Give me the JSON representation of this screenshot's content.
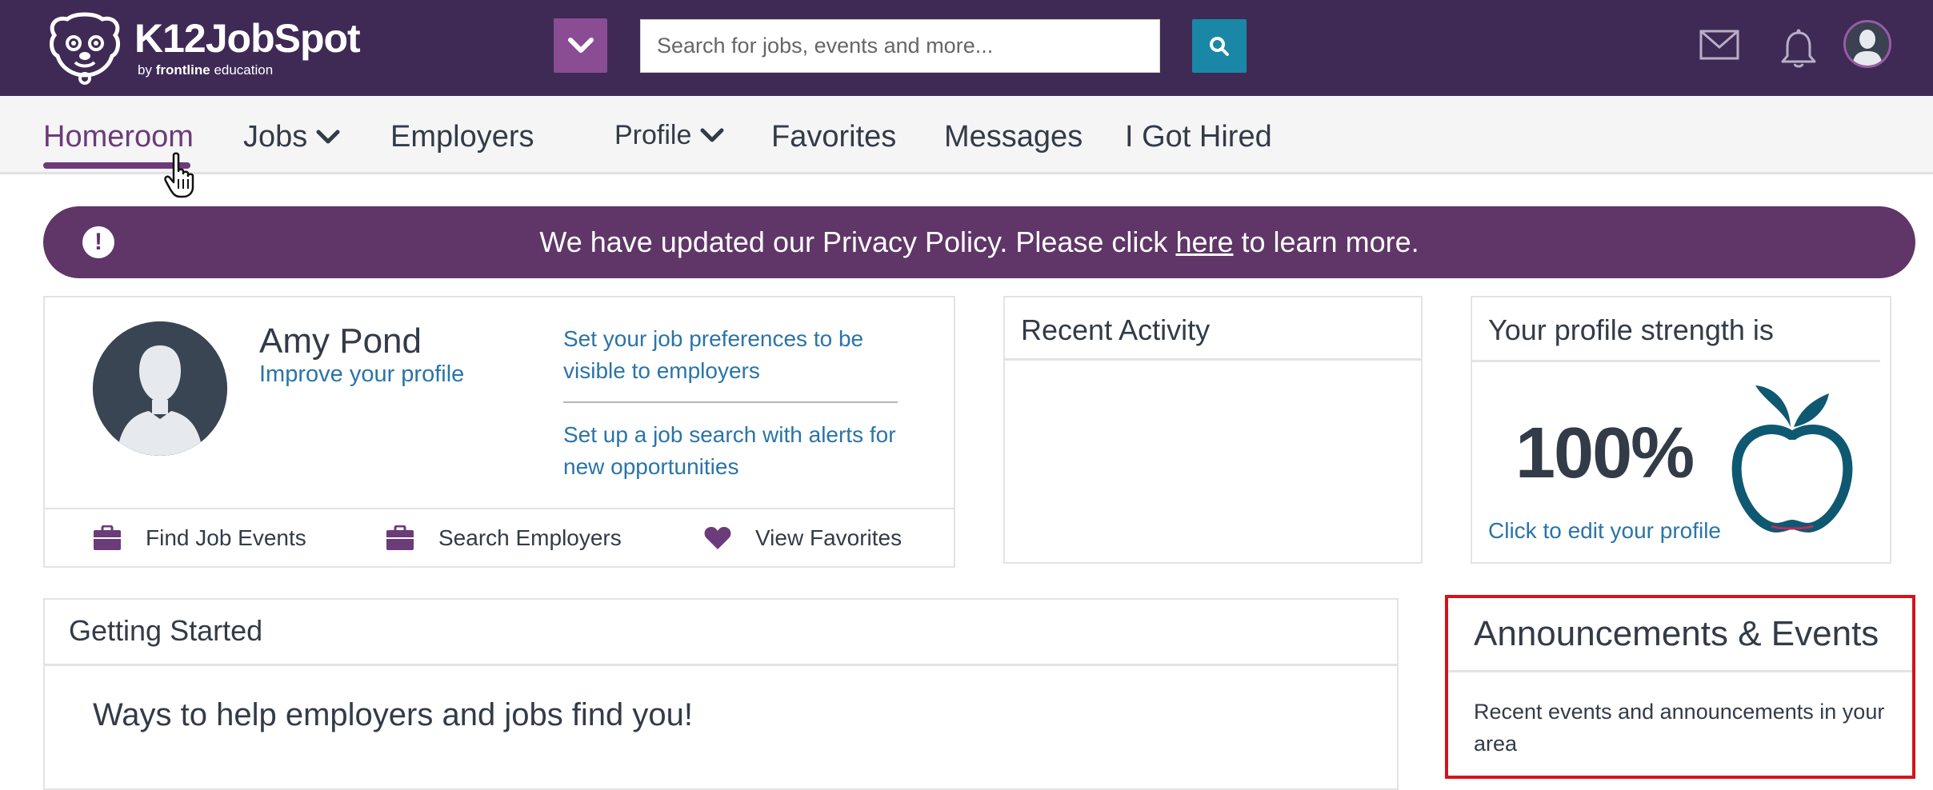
{
  "header": {
    "brand_name": "K12JobSpot",
    "brand_by": "by",
    "brand_company": "frontline",
    "brand_suffix": "education",
    "search_placeholder": "Search for jobs, events and more..."
  },
  "nav": {
    "items": [
      {
        "label": "Homeroom",
        "active": true
      },
      {
        "label": "Jobs",
        "has_dropdown": true
      },
      {
        "label": "Employers"
      },
      {
        "label": "Profile",
        "has_dropdown": true
      },
      {
        "label": "Favorites"
      },
      {
        "label": "Messages"
      },
      {
        "label": "I Got Hired"
      }
    ]
  },
  "banner": {
    "icon": "!",
    "text_before": "We have updated our Privacy Policy. Please click ",
    "link_text": "here",
    "text_after": " to learn more."
  },
  "profile": {
    "name": "Amy Pond",
    "improve_link": "Improve your profile",
    "preferences_link": "Set your job preferences to be visible to employers",
    "search_alert_link": "Set up a job search with alerts for new opportunities",
    "actions": [
      {
        "label": "Find Job Events",
        "icon": "briefcase-icon"
      },
      {
        "label": "Search Employers",
        "icon": "briefcase-icon"
      },
      {
        "label": "View Favorites",
        "icon": "heart-icon"
      }
    ]
  },
  "recent_activity": {
    "title": "Recent Activity"
  },
  "strength": {
    "title": "Your profile strength is",
    "value": "100%",
    "edit_link": "Click to edit your profile"
  },
  "getting_started": {
    "title": "Getting Started",
    "subtitle": "Ways to help employers and jobs find you!"
  },
  "announcements": {
    "title": "Announcements & Events",
    "text": "Recent events and announcements in your area"
  },
  "colors": {
    "header_bg": "#3f2a56",
    "accent_purple": "#6b3b7a",
    "banner_bg": "#5f3667",
    "search_button": "#1a87a6",
    "link_blue": "#2a74a8",
    "highlight_red": "#d4131d"
  }
}
